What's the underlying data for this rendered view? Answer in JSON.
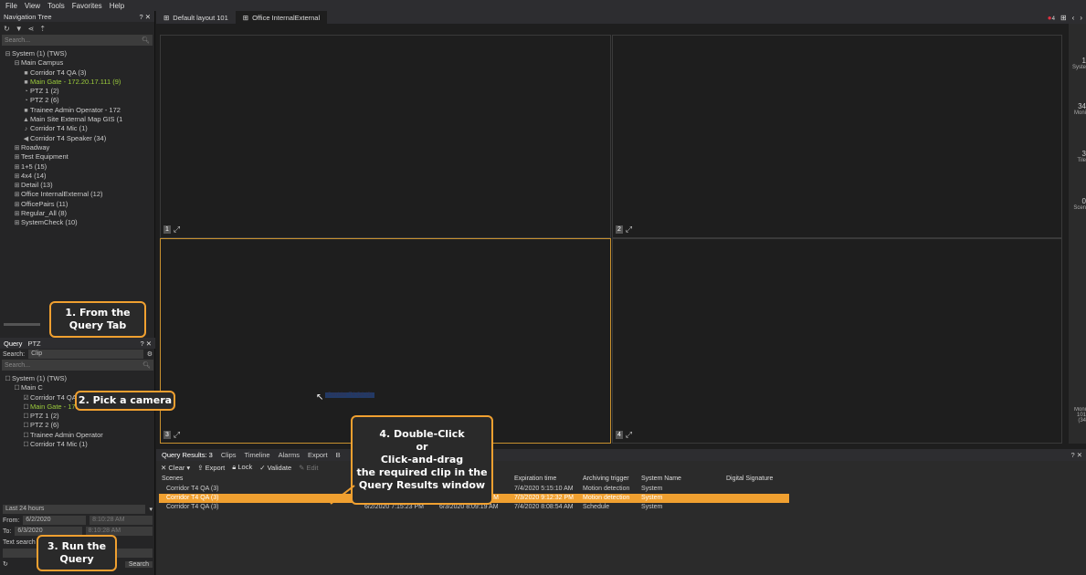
{
  "menu": [
    "File",
    "View",
    "Tools",
    "Favorites",
    "Help"
  ],
  "nav": {
    "title": "Navigation Tree",
    "controls": "? ✕",
    "search_placeholder": "Search...",
    "items": [
      {
        "indent": 0,
        "icon": "⊟",
        "label": "System (1) (TWS)"
      },
      {
        "indent": 1,
        "icon": "⊟",
        "label": "Main Campus"
      },
      {
        "indent": 2,
        "icon": "■",
        "label": "Corridor T4 QA (3)"
      },
      {
        "indent": 2,
        "icon": "■",
        "label": "Main Gate - 172.20.17.111 (9)",
        "hl": true
      },
      {
        "indent": 2,
        "icon": "◔",
        "label": "PTZ 1 (2)"
      },
      {
        "indent": 2,
        "icon": "◔",
        "label": "PTZ 2 (6)"
      },
      {
        "indent": 2,
        "icon": "■",
        "label": "Trainee Admin Operator - 172"
      },
      {
        "indent": 2,
        "icon": "▲",
        "label": "Main Site External Map GIS (1"
      },
      {
        "indent": 2,
        "icon": "♪",
        "label": "Corridor T4 Mic (1)"
      },
      {
        "indent": 2,
        "icon": "◀",
        "label": "Corridor T4 Speaker (34)"
      },
      {
        "indent": 1,
        "icon": "⊞",
        "label": "Roadway"
      },
      {
        "indent": 1,
        "icon": "⊞",
        "label": "Test Equipment"
      },
      {
        "indent": 1,
        "icon": "⊞",
        "label": "1+5 (15)"
      },
      {
        "indent": 1,
        "icon": "⊞",
        "label": "4x4 (14)"
      },
      {
        "indent": 1,
        "icon": "⊞",
        "label": "Detail (13)"
      },
      {
        "indent": 1,
        "icon": "⊞",
        "label": "Office InternalExternal (12)"
      },
      {
        "indent": 1,
        "icon": "⊞",
        "label": "OfficePairs (11)"
      },
      {
        "indent": 1,
        "icon": "⊞",
        "label": "Regular_All (8)"
      },
      {
        "indent": 1,
        "icon": "⊞",
        "label": "SystemCheck (10)"
      }
    ]
  },
  "query_panel": {
    "tabs": [
      "Query",
      "PTZ"
    ],
    "controls": "? ✕",
    "search_label": "Search:",
    "search_value": "Clip",
    "search_placeholder": "Search...",
    "items": [
      {
        "indent": 0,
        "label": "System (1) (TWS)"
      },
      {
        "indent": 1,
        "label": "Main C"
      },
      {
        "indent": 2,
        "label": "Corridor T4 QA (3)",
        "checked": true
      },
      {
        "indent": 2,
        "label": "Main Gate - 172.20.17.1",
        "hl": true
      },
      {
        "indent": 2,
        "label": "PTZ 1 (2)"
      },
      {
        "indent": 2,
        "label": "PTZ 2 (6)"
      },
      {
        "indent": 2,
        "label": "Trainee Admin Operator"
      },
      {
        "indent": 2,
        "label": "Corridor T4 Mic (1)"
      }
    ],
    "range": "Last 24 hours",
    "from_label": "From:",
    "from_date": "6/2/2020",
    "from_time": "8:10:28 AM",
    "to_label": "To:",
    "to_date": "6/3/2020",
    "to_time": "8:10:28 AM",
    "text_search_label": "Text search",
    "search_button": "Search"
  },
  "layout_tabs": [
    "Default layout 101",
    "Office InternalExternal"
  ],
  "alarm_count": "4",
  "tiles": [
    "1",
    "2",
    "3",
    "4"
  ],
  "drag_label": "Corridor T4 QA (3)",
  "right_stats": [
    {
      "value": "1",
      "label": "Syste"
    },
    {
      "value": "34",
      "label": "Moni"
    },
    {
      "value": "3",
      "label": "Tile"
    },
    {
      "value": "0",
      "label": "Scen"
    }
  ],
  "right_bottom": [
    "Moni",
    "101",
    "(34"
  ],
  "results": {
    "tabs": [
      "Query Results: 3",
      "Clips",
      "Timeline",
      "Alarms",
      "Export",
      "B"
    ],
    "close": "? ✕",
    "tools": [
      "Clear",
      "Export",
      "Lock",
      "Validate",
      "Edit"
    ],
    "columns": [
      "Scenes",
      "",
      "",
      "Expiration time",
      "Archiving trigger",
      "System Name",
      "Digital Signature"
    ],
    "rows": [
      [
        "Corridor T4 QA (3)",
        "",
        "M",
        "7/4/2020 5:15:10 AM",
        "Motion detection",
        "System",
        ""
      ],
      [
        "Corridor T4 QA (3)",
        "6/2/2020 9:10:51 PM",
        "6/2/2020 9:12:32 PM",
        "7/3/2020 9:12:32 PM",
        "Motion detection",
        "System",
        ""
      ],
      [
        "Corridor T4 QA (3)",
        "6/2/2020 7:15:23 PM",
        "6/3/2020 8:09:19 AM",
        "7/4/2020 8:08:54 AM",
        "Schedule",
        "System",
        ""
      ]
    ]
  },
  "callouts": {
    "c1": [
      "1. From the",
      "Query Tab"
    ],
    "c2": [
      "2. Pick a camera"
    ],
    "c3": [
      "3. Run the",
      "Query"
    ],
    "c4": [
      "4. Double-Click",
      "or",
      "Click-and-drag",
      "the required clip in the",
      "Query Results window"
    ]
  },
  "colors": {
    "accent": "#f0a030",
    "highlight": "#9ccc3c",
    "alarm": "#e03040"
  }
}
